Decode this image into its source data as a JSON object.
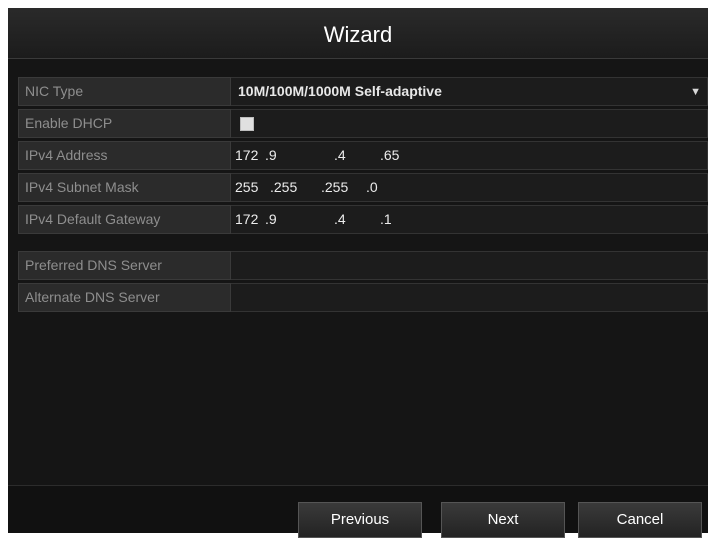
{
  "window": {
    "title": "Wizard"
  },
  "network": {
    "nic_type": {
      "label": "NIC Type",
      "value": "10M/100M/1000M Self-adaptive"
    },
    "dhcp": {
      "label": "Enable DHCP",
      "checked": true
    },
    "ipv4_address": {
      "label": "IPv4 Address",
      "octets": [
        "172",
        ".9",
        ".4",
        ".65"
      ]
    },
    "subnet_mask": {
      "label": "IPv4 Subnet Mask",
      "octets": [
        "255",
        ".255",
        ".255",
        ".0"
      ]
    },
    "gateway": {
      "label": "IPv4 Default Gateway",
      "octets": [
        "172",
        ".9",
        ".4",
        ".1"
      ]
    },
    "preferred_dns": {
      "label": "Preferred DNS Server",
      "value": ""
    },
    "alternate_dns": {
      "label": "Alternate DNS Server",
      "value": ""
    }
  },
  "buttons": {
    "previous": "Previous",
    "next": "Next",
    "cancel": "Cancel"
  },
  "icons": {
    "dropdown": "chevron-down-icon"
  },
  "colors": {
    "background": "#151515",
    "label_text": "#8e8e8e",
    "value_text": "#e8e8e8"
  }
}
